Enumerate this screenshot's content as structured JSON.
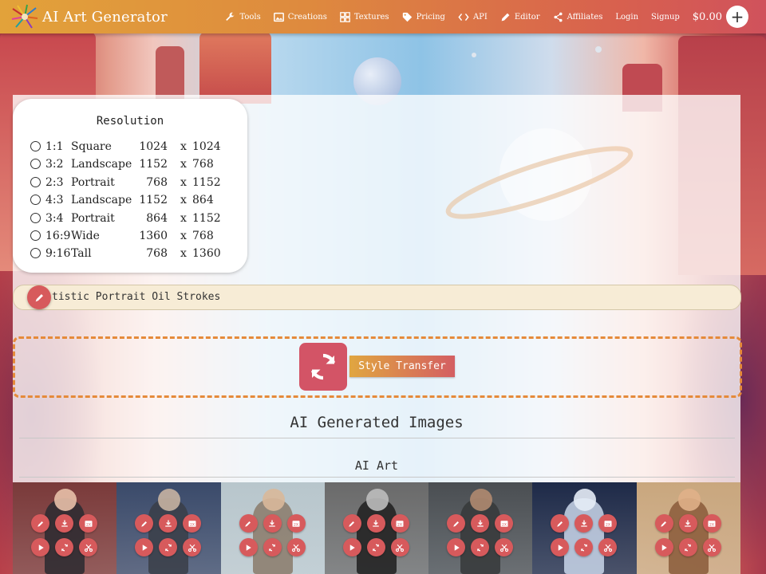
{
  "header": {
    "app_title": "AI Art Generator",
    "nav": [
      {
        "label": "Tools",
        "icon": "wrench-icon"
      },
      {
        "label": "Creations",
        "icon": "image-icon"
      },
      {
        "label": "Textures",
        "icon": "grid-icon"
      },
      {
        "label": "Pricing",
        "icon": "tag-icon"
      },
      {
        "label": "API",
        "icon": "code-icon"
      },
      {
        "label": "Editor",
        "icon": "pencil-icon"
      },
      {
        "label": "Affiliates",
        "icon": "share-icon"
      }
    ],
    "login": "Login",
    "signup": "Signup",
    "balance": "$0.00",
    "add_funds": "+"
  },
  "resolution": {
    "heading": "Resolution",
    "options": [
      {
        "ratio": "1:1",
        "name": "Square",
        "w": "1024",
        "x": "x",
        "h": "1024"
      },
      {
        "ratio": "3:2",
        "name": "Landscape",
        "w": "1152",
        "x": "x",
        "h": "768"
      },
      {
        "ratio": "2:3",
        "name": "Portrait",
        "w": "768",
        "x": "x",
        "h": "1152"
      },
      {
        "ratio": "4:3",
        "name": "Landscape",
        "w": "1152",
        "x": "x",
        "h": "864"
      },
      {
        "ratio": "3:4",
        "name": "Portrait",
        "w": "864",
        "x": "x",
        "h": "1152"
      },
      {
        "ratio": "16:9",
        "name": "Wide",
        "w": "1360",
        "x": "x",
        "h": "768"
      },
      {
        "ratio": "9:16",
        "name": "Tall",
        "w": "768",
        "x": "x",
        "h": "1360"
      }
    ]
  },
  "prompt": {
    "value": "tistic Portrait Oil Strokes"
  },
  "style_transfer": {
    "label": "Style Transfer"
  },
  "section": {
    "title": "AI Generated Images",
    "subtitle": "AI Art"
  },
  "gallery": [
    {
      "bg": "#7a3a3a",
      "fig": "#2a2a30",
      "skin": "#e8c0a8"
    },
    {
      "bg": "#3a4a6a",
      "fig": "#3a3e48",
      "skin": "#c7b2a2"
    },
    {
      "bg": "#b8c6cc",
      "fig": "#8a7a6a",
      "skin": "#d9b89a"
    },
    {
      "bg": "#6a6a6a",
      "fig": "#1e1e1e",
      "skin": "#bdbdbd"
    },
    {
      "bg": "#4a4e52",
      "fig": "#36383a",
      "skin": "#b08a70"
    },
    {
      "bg": "#1e2a48",
      "fig": "#c9d6ea",
      "skin": "#e6ecf6"
    },
    {
      "bg": "#c9a77e",
      "fig": "#8a5a3a",
      "skin": "#e0b088"
    }
  ],
  "tile_actions": [
    "edit-icon",
    "download-icon",
    "upscale-icon",
    "play-icon",
    "refresh-icon",
    "scissors-icon"
  ]
}
